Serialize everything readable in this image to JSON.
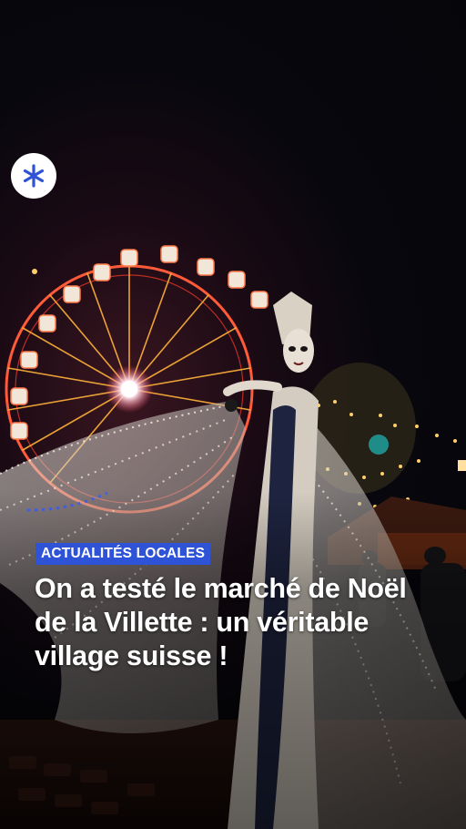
{
  "tag": {
    "label": "ACTUALITÉS LOCALES"
  },
  "headline": {
    "text": "On a testé le marché de Noël de la Villette : un véritable village suisse !"
  },
  "logo": {
    "icon": "asterisk-icon",
    "color": "#2f53d6"
  },
  "colors": {
    "tag_background": "#2f53d6",
    "text": "#ffffff"
  }
}
